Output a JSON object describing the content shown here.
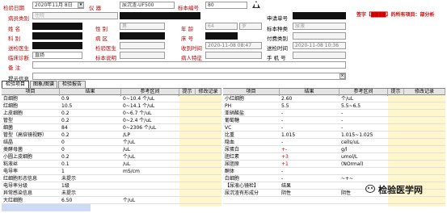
{
  "header": {
    "date_label": "检验日期",
    "date_value": "2020年11月 8日",
    "instrument_label": "仪  器",
    "instrument_value": "尿沉渣-UF500",
    "specimen_no_label": "标本编号",
    "specimen_no_value": "80",
    "warning_icon": "warning-triangle-icon",
    "alert_text": "签字【████】的所有项目：部分析"
  },
  "form": {
    "patient_type_label": "病员类别",
    "patient_type_value": "住院",
    "name_label": "姓  名",
    "sex_label": "性  别",
    "sex_value": "男",
    "age_label": "年  龄",
    "age_value": "64",
    "age_unit": "岁",
    "apply_no_label": "申请单号",
    "dept_label": "科  别",
    "ward_label": "病  区",
    "bed_label": "床  号",
    "specimen_type_label": "标本种类",
    "specimen_type_value": "尿液",
    "doctor_label": "送检医生",
    "collect_time_label": "采样时间",
    "fee_status_label": "付费类别",
    "diagnosis_label": "临床诊断",
    "diagnosis_value": "直肠",
    "specimen_desc_label": "标本说明",
    "patient_feature_label": "病人特征",
    "received_time_label": "收到时间",
    "received_time_value": "2020-11-08 08:47",
    "send_time_label": "送检时间",
    "send_time_value": "2020-11-08 10:36",
    "phone_label": "手 机 号",
    "remark_label": "备  注",
    "inspector_label": "检验医生",
    "hint_label": "提示信息"
  },
  "tabs": [
    "检验项目",
    "图象/图谱",
    "检验报告"
  ],
  "left_table": {
    "columns": [
      "项目",
      "结果",
      "参考区间",
      "提示",
      "修改记录"
    ],
    "rows": [
      [
        "白细胞",
        "0.9",
        "0~10.4 个/uL",
        "",
        ""
      ],
      [
        "红细胞",
        "10.5",
        "0~14.1 个/uL",
        "",
        ""
      ],
      [
        "上皮细胞",
        "0.2",
        "0~6.7 个/uL",
        "",
        ""
      ],
      [
        "管型",
        "0.2",
        "0~2.4 个/uL",
        "",
        ""
      ],
      [
        "细菌",
        "84",
        "0~2306 个/uL",
        "",
        ""
      ],
      [
        "管型（高倍镜视野）",
        "0.2",
        "/LP",
        "",
        ""
      ],
      [
        "结晶",
        "0",
        "个/uL",
        "",
        ""
      ],
      [
        "类酵母菌",
        "0",
        "/uL",
        "",
        ""
      ],
      [
        "小圆上皮细胞",
        "0.2",
        "个/uL",
        "",
        ""
      ],
      [
        "粘液丝",
        "0.1",
        "/uL",
        "",
        ""
      ],
      [
        "电导率",
        "1",
        "mS/cm",
        "",
        ""
      ],
      [
        "红细胞形态信息",
        "未提示",
        "",
        "",
        ""
      ],
      [
        "电导率分级",
        "1级",
        "",
        "",
        ""
      ],
      [
        "异常感染信息",
        "未提示",
        "",
        "",
        ""
      ],
      [
        "大红细胞",
        "6.50",
        "个/uL",
        "",
        ""
      ]
    ]
  },
  "right_table": {
    "columns": [
      "项目",
      "结果",
      "参考区间",
      "提示",
      "修改记录"
    ],
    "rows": [
      [
        "小红细胞",
        "2.60",
        "个/uL",
        "",
        ""
      ],
      [
        "PH",
        "5.5",
        "5.5~6.5",
        "",
        ""
      ],
      [
        "亚硝酸盐",
        "-",
        "-",
        "",
        ""
      ],
      [
        "葡萄糖",
        "-",
        "-",
        "",
        ""
      ],
      [
        "VC",
        "-",
        "-",
        "",
        ""
      ],
      [
        "比重",
        "1.015",
        "1.015~1.025",
        "",
        ""
      ],
      [
        "隐血",
        "-",
        "cells/uL",
        "",
        ""
      ],
      [
        "尿蛋白",
        "+-",
        "g/l",
        "",
        ""
      ],
      [
        "胆红素",
        "+3",
        "umol/L",
        "",
        ""
      ],
      [
        "尿胆原",
        "+1",
        "(NOrmal)",
        "",
        ""
      ],
      [
        "酮体",
        "-",
        "",
        "",
        ""
      ],
      [
        "白细胞",
        "-",
        "~+~",
        "",
        ""
      ],
      [
        "【尿液心镜检】",
        "结果",
        "",
        "",
        ""
      ],
      [
        "尿沉渣有形成分",
        "阴性",
        "阴性",
        "",
        ""
      ],
      [
        "",
        "",
        "",
        "",
        ""
      ]
    ]
  },
  "watermark": {
    "wechat_icon": "wechat-icon",
    "text": "检验医学网"
  },
  "colors": {
    "label_red": "#c00000",
    "alert_red": "#d00000",
    "highlight": "#fff6cc",
    "result_red": "#d00000"
  }
}
